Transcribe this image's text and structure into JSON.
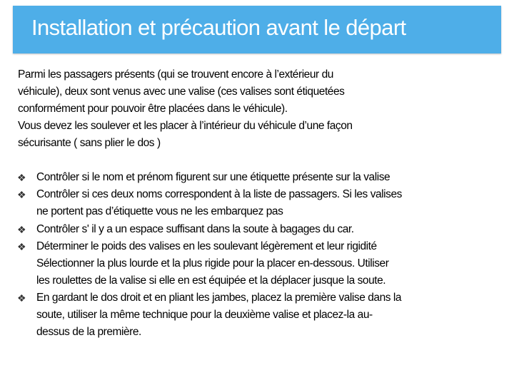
{
  "title": "Installation et précaution avant le départ",
  "intro_lines": [
    "Parmi les passagers présents (qui se trouvent encore à l’extérieur du",
    "véhicule), deux sont venus avec une valise (ces valises sont étiquetées",
    "conformément pour pouvoir être placées dans le véhicule).",
    "Vous devez les soulever et les placer à l’intérieur du véhicule d’une façon",
    "sécurisante ( sans plier le dos )"
  ],
  "bullet_icon": "diamond-bullet-icon",
  "bullets": [
    {
      "lines": [
        "Contrôler si le nom et prénom figurent sur une étiquette présente sur la valise"
      ]
    },
    {
      "lines": [
        "Contrôler si ces deux noms correspondent à la liste de passagers. Si les valises",
        "ne portent pas d’étiquette vous ne les embarquez pas"
      ]
    },
    {
      "lines": [
        "Contrôler s' il y a un espace suffisant dans la soute à bagages du car."
      ]
    },
    {
      "lines": [
        "Déterminer le poids des valises en les soulevant légèrement et leur rigidité",
        "Sélectionner la plus lourde et la plus rigide pour la placer en-dessous. Utiliser",
        "les roulettes de la valise si elle en est équipée et la déplacer jusque la soute."
      ]
    },
    {
      "lines": [
        "En gardant le dos droit et en pliant les jambes, placez la première valise dans la",
        "soute, utiliser la même technique pour la deuxième valise et placez-la au-",
        "dessus de la première."
      ]
    }
  ],
  "colors": {
    "title_bar": "#4eaee8",
    "title_text": "#ffffff"
  }
}
